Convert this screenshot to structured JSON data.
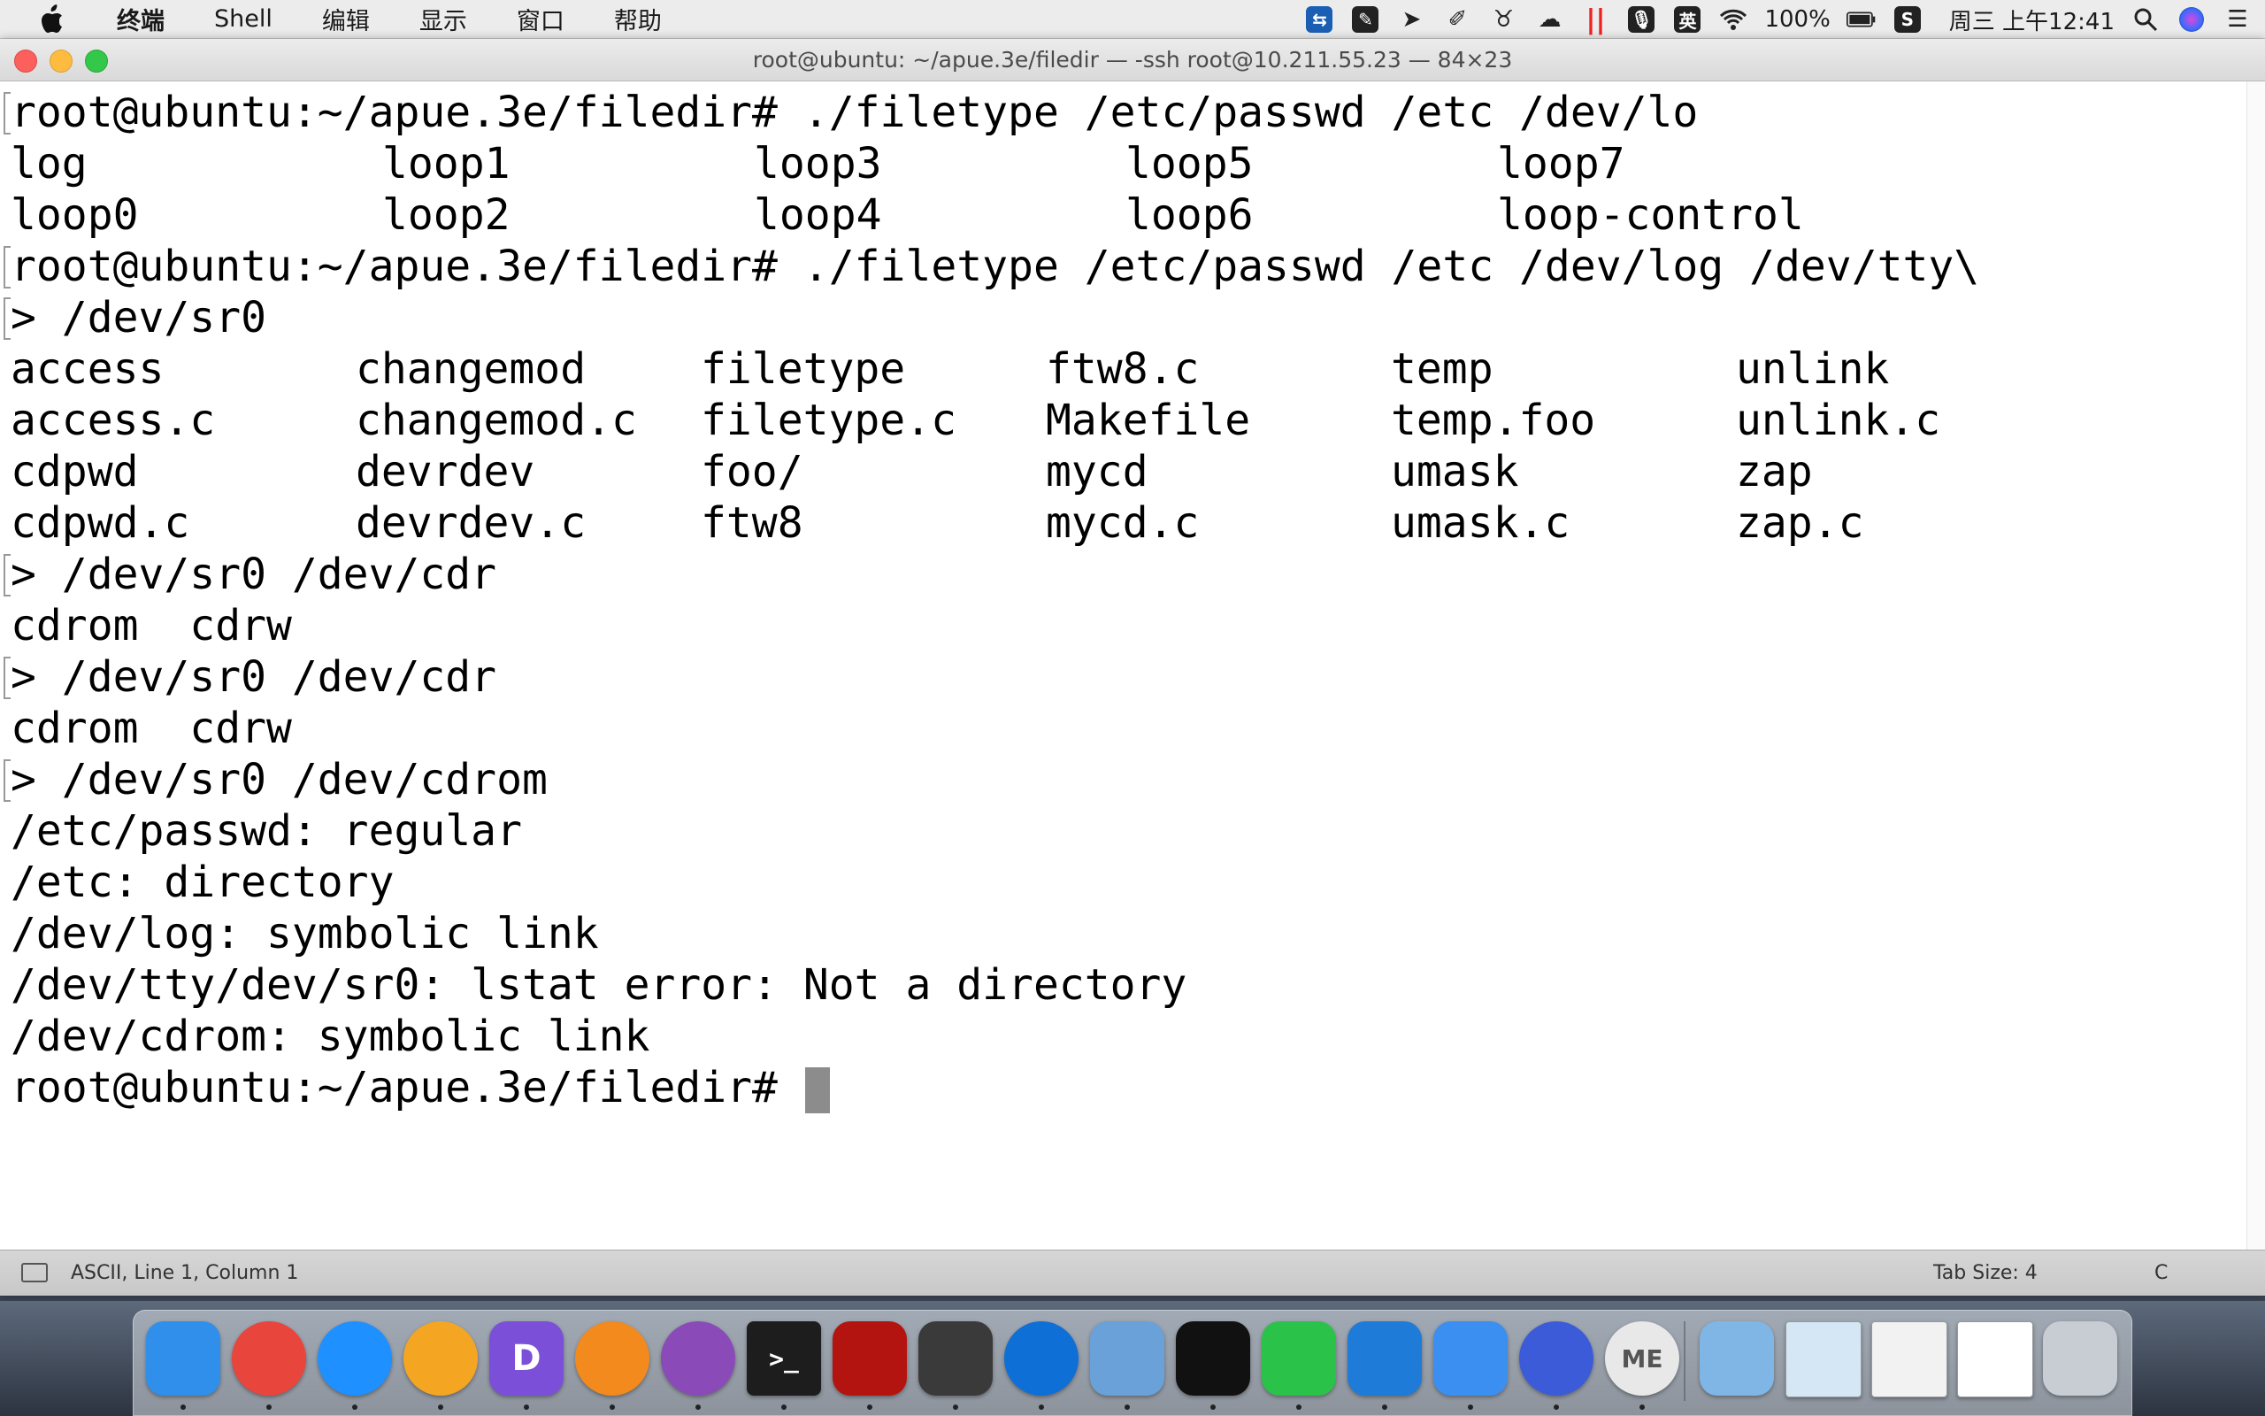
{
  "menubar": {
    "apple_icon": "apple-icon",
    "items": [
      {
        "label": "终端",
        "bold": true
      },
      {
        "label": "Shell"
      },
      {
        "label": "编辑"
      },
      {
        "label": "显示"
      },
      {
        "label": "窗口"
      },
      {
        "label": "帮助"
      }
    ],
    "status": {
      "input_method": "英",
      "battery_percent": "100%",
      "clock": "周三 上午12:41"
    }
  },
  "window": {
    "title": "root@ubuntu: ~/apue.3e/filedir — -ssh root@10.211.55.23 — 84×23"
  },
  "terminal": {
    "prompt": "root@ubuntu:~/apue.3e/filedir# ",
    "cmd1": "./filetype /etc/passwd /etc /dev/lo",
    "completion1": [
      [
        "log",
        "loop1",
        "loop3",
        "loop5",
        "loop7"
      ],
      [
        "loop0",
        "loop2",
        "loop4",
        "loop6",
        "loop-control"
      ]
    ],
    "cmd2": "./filetype /etc/passwd /etc /dev/log /dev/tty\\",
    "cont1": "> /dev/sr0",
    "completion2": [
      [
        "access",
        "changemod",
        "filetype",
        "ftw8.c",
        "temp",
        "unlink"
      ],
      [
        "access.c",
        "changemod.c",
        "filetype.c",
        "Makefile",
        "temp.foo",
        "unlink.c"
      ],
      [
        "cdpwd",
        "devrdev",
        "foo/",
        "mycd",
        "umask",
        "zap"
      ],
      [
        "cdpwd.c",
        "devrdev.c",
        "ftw8",
        "mycd.c",
        "umask.c",
        "zap.c"
      ]
    ],
    "cont2": "> /dev/sr0 /dev/cdr",
    "completion3": "cdrom  cdrw",
    "cont3": "> /dev/sr0 /dev/cdr",
    "completion4": "cdrom  cdrw",
    "cont4": "> /dev/sr0 /dev/cdrom",
    "output": [
      "/etc/passwd: regular",
      "/etc: directory",
      "/dev/log: symbolic link",
      "/dev/tty/dev/sr0: lstat error: Not a directory",
      "/dev/cdrom: symbolic link"
    ],
    "final_prompt": "root@ubuntu:~/apue.3e/filedir# "
  },
  "statusbar": {
    "position": "ASCII, Line 1, Column 1",
    "tab_size": "Tab Size: 4",
    "language": "C"
  },
  "dock": {
    "apps": [
      {
        "name": "finder",
        "color": "#2f8fea"
      },
      {
        "name": "chrome",
        "color": "#e8453c"
      },
      {
        "name": "safari",
        "color": "#1e90ff"
      },
      {
        "name": "photos",
        "color": "#f4a623"
      },
      {
        "name": "dash",
        "color": "#7b4fd8"
      },
      {
        "name": "ibooks",
        "color": "#f28a1d"
      },
      {
        "name": "github",
        "color": "#8a4bb8"
      },
      {
        "name": "terminal",
        "color": "#1d1d1d"
      },
      {
        "name": "acrobat",
        "color": "#b3140f"
      },
      {
        "name": "sublime-text",
        "color": "#3a3a3a"
      },
      {
        "name": "teamviewer",
        "color": "#0e6fd6"
      },
      {
        "name": "parallels",
        "color": "#6aa1d8"
      },
      {
        "name": "console",
        "color": "#111111"
      },
      {
        "name": "wechat",
        "color": "#2bc24a"
      },
      {
        "name": "xcode",
        "color": "#1e7bd8"
      },
      {
        "name": "notes-app",
        "color": "#3b8ff0"
      },
      {
        "name": "taurus",
        "color": "#3b5bd8"
      },
      {
        "name": "me-app",
        "color": "#e8e8e8"
      },
      {
        "name": "folder",
        "color": "#7fb6e6"
      },
      {
        "name": "window-thumb-1",
        "color": "#d5e6f5"
      },
      {
        "name": "window-thumb-2",
        "color": "#f2f2f2"
      },
      {
        "name": "window-thumb-3",
        "color": "#ffffff"
      },
      {
        "name": "trash",
        "color": "#c8cdd4"
      }
    ],
    "labels": {
      "github": "",
      "terminal": ">_",
      "dash": "D",
      "me-app": "ME"
    }
  }
}
